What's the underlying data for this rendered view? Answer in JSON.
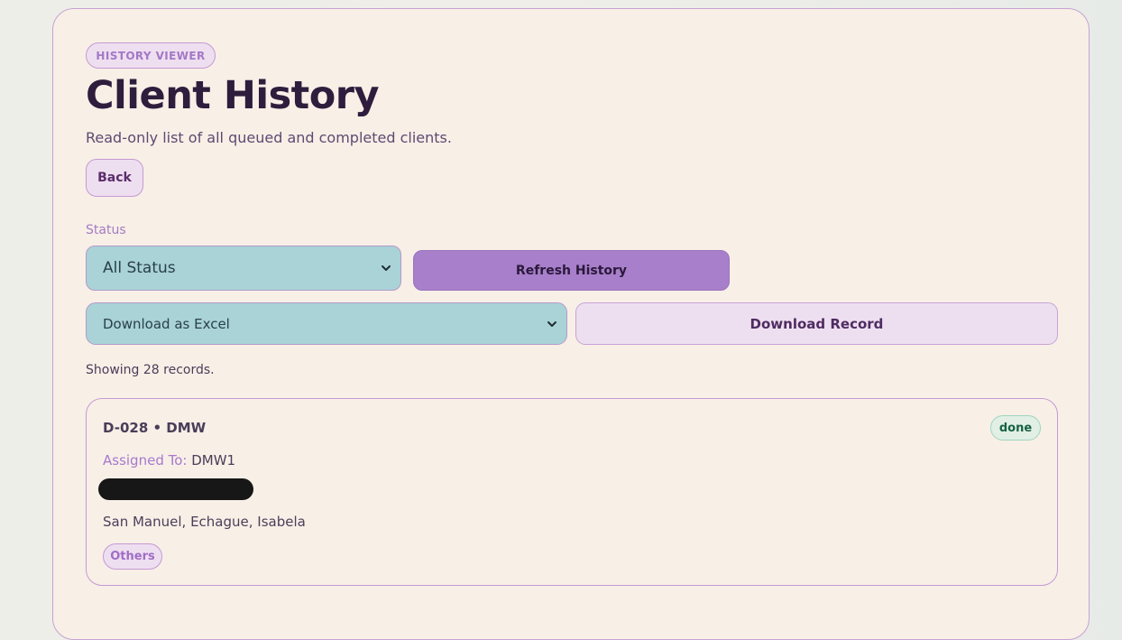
{
  "header": {
    "eyebrow": "HISTORY VIEWER",
    "title": "Client History",
    "subtitle": "Read-only list of all queued and completed clients.",
    "back_label": "Back"
  },
  "filters": {
    "status_label": "Status",
    "status_selected": "All Status",
    "refresh_label": "Refresh History",
    "download_format_selected": "Download as Excel",
    "download_label": "Download Record"
  },
  "results": {
    "summary": "Showing 28 records."
  },
  "records": [
    {
      "id_line": "D-028 • DMW",
      "status": "done",
      "assigned_label": "Assigned To:",
      "assigned_value": "DMW1",
      "location": "San Manuel, Echague, Isabela",
      "category": "Others"
    }
  ],
  "icons": {
    "select_chevron": "chevron-down-icon"
  },
  "colors": {
    "page_background": "#eeeee8",
    "panel_background": "#f8efe7",
    "accent_purple": "#a77fca",
    "select_teal": "#a9d3d7",
    "done_green": "#166343"
  }
}
